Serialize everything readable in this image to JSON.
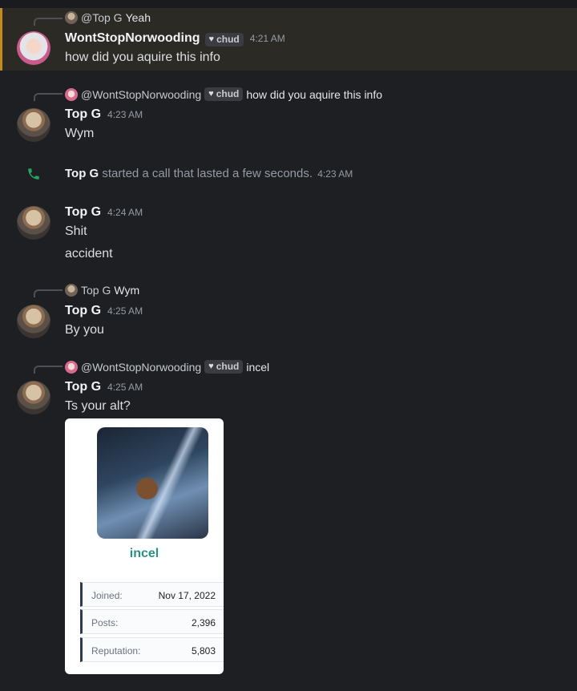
{
  "messages": {
    "m1": {
      "reply_name": "@Top G",
      "reply_text": "Yeah",
      "author": "WontStopNorwooding",
      "tag": "chud",
      "time": "4:21 AM",
      "text": "how did you aquire this info"
    },
    "m2": {
      "reply_name": "@WontStopNorwooding",
      "reply_tag": "chud",
      "reply_text": "how did you aquire this info",
      "author": "Top G",
      "time": "4:23 AM",
      "text": "Wym"
    },
    "call": {
      "author": "Top G",
      "text": "started a call that lasted a few seconds.",
      "time": "4:23 AM"
    },
    "m3": {
      "author": "Top G",
      "time": "4:24 AM",
      "text1": "Shit",
      "text2": "accident"
    },
    "m4": {
      "reply_name": "Top G",
      "reply_text": "Wym",
      "author": "Top G",
      "time": "4:25 AM",
      "text": "By you"
    },
    "m5": {
      "reply_name": "@WontStopNorwooding",
      "reply_tag": "chud",
      "reply_text": "incel",
      "author": "Top G",
      "time": "4:25 AM",
      "text": "Ts your alt?"
    }
  },
  "embed": {
    "title": "incel",
    "stats": [
      {
        "label": "Joined:",
        "value": "Nov 17, 2022"
      },
      {
        "label": "Posts:",
        "value": "2,396"
      },
      {
        "label": "Reputation:",
        "value": "5,803"
      }
    ]
  },
  "colors": {
    "background": "#1e1f22",
    "highlight_bar": "#c48a1c",
    "call_icon": "#23a55a",
    "embed_title": "#2a8f86"
  }
}
